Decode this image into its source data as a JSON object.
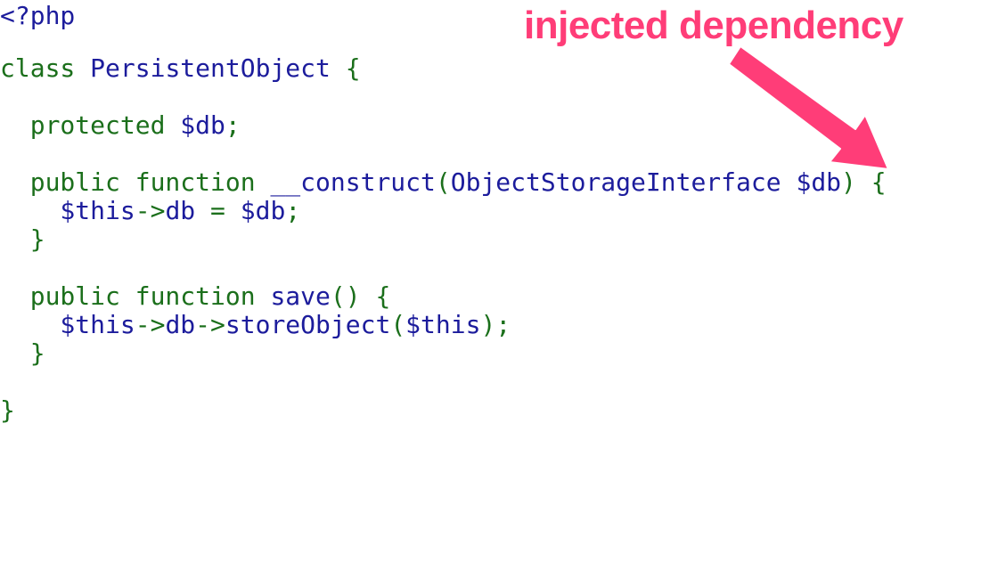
{
  "annotation": {
    "text": "injected dependency",
    "color": "#ff3d78"
  },
  "colors": {
    "keyword": "#1b6f1b",
    "identifier": "#1c1c9c"
  },
  "code": {
    "l1": {
      "t1": "<?php"
    },
    "l2": {
      "t1": "class ",
      "t2": "PersistentObject",
      "t3": " {"
    },
    "l3": {
      "t1": "  protected ",
      "t2": "$db",
      "t3": ";"
    },
    "l4": {
      "t1": "  public function ",
      "t2": "__construct",
      "t3": "(",
      "t4": "ObjectStorageInterface $db",
      "t5": ") {"
    },
    "l5": {
      "t1": "    $this",
      "t2": "->",
      "t3": "db",
      "t4": " = ",
      "t5": "$db",
      "t6": ";"
    },
    "l6": {
      "t1": "  }"
    },
    "l7": {
      "t1": "  public function ",
      "t2": "save",
      "t3": "() {"
    },
    "l8": {
      "t1": "    $this",
      "t2": "->",
      "t3": "db",
      "t4": "->",
      "t5": "storeObject",
      "t6": "(",
      "t7": "$this",
      "t8": ");"
    },
    "l9": {
      "t1": "  }"
    },
    "l10": {
      "t1": "}"
    }
  }
}
